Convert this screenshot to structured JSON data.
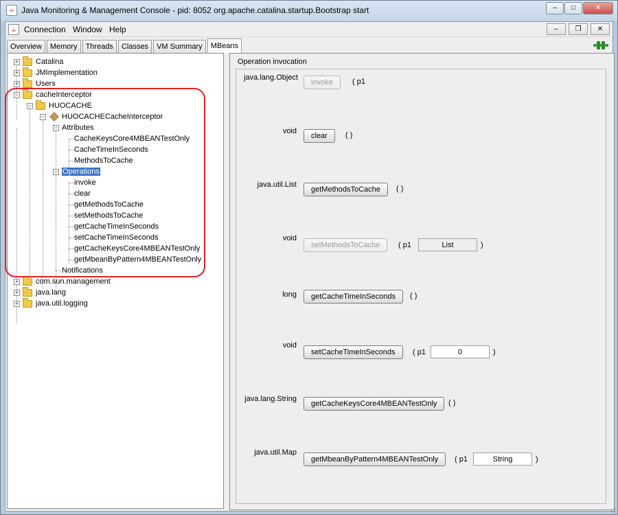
{
  "window": {
    "title": "Java Monitoring & Management Console - pid: 8052 org.apache.catalina.startup.Bootstrap start",
    "minimize_label": "–",
    "maximize_label": "□",
    "close_label": "✕"
  },
  "menu": {
    "items": [
      "Connection",
      "Window",
      "Help"
    ],
    "inner_minimize": "–",
    "inner_restore": "❐",
    "inner_close": "✕"
  },
  "tabs": [
    {
      "label": "Overview"
    },
    {
      "label": "Memory"
    },
    {
      "label": "Threads"
    },
    {
      "label": "Classes"
    },
    {
      "label": "VM Summary"
    },
    {
      "label": "MBeans",
      "active": true
    }
  ],
  "tree": {
    "catalina": "Catalina",
    "jmimplementation": "JMImplementation",
    "users": "Users",
    "cacheinterceptor": "cacheInterceptor",
    "huocache": "HUOCACHE",
    "bean": "HUOCACHECacheInterceptor",
    "attributes": "Attributes",
    "attribute_items": [
      "CacheKeysCore4MBEANTestOnly",
      "CacheTimeInSeconds",
      "MethodsToCache"
    ],
    "operations": "Operations",
    "operation_items": [
      "invoke",
      "clear",
      "getMethodsToCache",
      "setMethodsToCache",
      "getCacheTimeInSeconds",
      "setCacheTimeInSeconds",
      "getCacheKeysCore4MBEANTestOnly",
      "getMbeanByPattern4MBEANTestOnly"
    ],
    "notifications": "Notifications",
    "com_sun_management": "com.sun.management",
    "java_lang": "java.lang",
    "java_util_logging": "java.util.logging"
  },
  "invocation": {
    "title": "Operation invocation",
    "operations": [
      {
        "return_type": "java.lang.Object",
        "name": "invoke",
        "open": "( p1",
        "close": ""
      },
      {
        "return_type": "void",
        "name": "clear",
        "open": "( )",
        "close": ""
      },
      {
        "return_type": "java.util.List",
        "name": "getMethodsToCache",
        "open": "( )",
        "close": ""
      },
      {
        "return_type": "void",
        "name": "setMethodsToCache",
        "open": "( p1",
        "param": "List",
        "close": ")"
      },
      {
        "return_type": "long",
        "name": "getCacheTimeInSeconds",
        "open": "( )",
        "close": ""
      },
      {
        "return_type": "void",
        "name": "setCacheTimeInSeconds",
        "open": "( p1",
        "param": "0",
        "close": ")"
      },
      {
        "return_type": "java.lang.String",
        "name": "getCacheKeysCore4MBEANTestOnly",
        "open": "( )",
        "close": ""
      },
      {
        "return_type": "java.util.Map",
        "name": "getMbeanByPattern4MBEANTestOnly",
        "open": "( p1",
        "param": "String",
        "close": ")"
      }
    ]
  },
  "colors": {
    "selection": "#3b73c8",
    "highlight_oval": "#e0202a",
    "folder": "#f0c94b",
    "connect_icon": "#3aa13a"
  }
}
